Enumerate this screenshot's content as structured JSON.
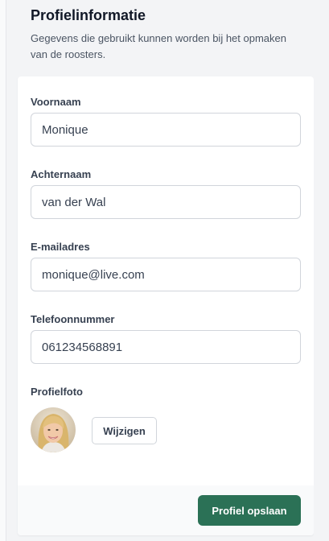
{
  "header": {
    "title": "Profielinformatie",
    "subtitle": "Gegevens die gebruikt kunnen worden bij het opmaken van de roosters."
  },
  "form": {
    "first_name": {
      "label": "Voornaam",
      "value": "Monique"
    },
    "last_name": {
      "label": "Achternaam",
      "value": "van der Wal"
    },
    "email": {
      "label": "E-mailadres",
      "value": "monique@live.com"
    },
    "phone": {
      "label": "Telefoonnummer",
      "value": "061234568891"
    },
    "photo": {
      "label": "Profielfoto",
      "change_label": "Wijzigen"
    }
  },
  "footer": {
    "save_label": "Profiel opslaan"
  },
  "colors": {
    "primary": "#2b7156",
    "background": "#f3f4f6",
    "card": "#ffffff"
  }
}
